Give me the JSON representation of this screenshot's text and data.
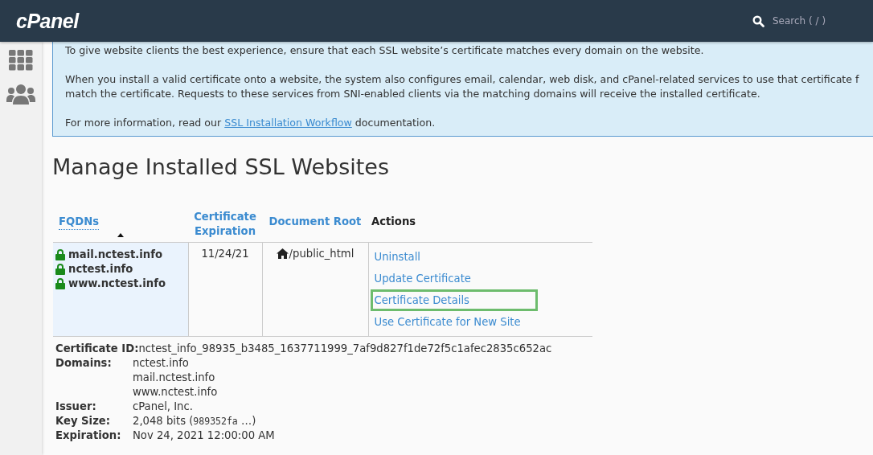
{
  "header": {
    "logo": "cPanel",
    "search": {
      "placeholder": "Search ( / )"
    }
  },
  "sidebar": {
    "items": [
      {
        "kind": "grid"
      },
      {
        "kind": "users"
      }
    ]
  },
  "notice": {
    "paragraphs": [
      {
        "lines": [
          "To give website clients the best experience, ensure that each SSL website’s certificate matches every domain on the website."
        ]
      },
      {
        "lines": [
          "When you install a valid certificate onto a website, the system also configures email, calendar, web disk, and cPanel-related services to use that certificate f",
          "match the certificate. Requests to these services from SNI-enabled clients via the matching domains will receive the installed certificate."
        ]
      },
      {
        "lines": [
          "For more information, read our "
        ],
        "link": "SSL Installation Workflow",
        "after": " documentation."
      }
    ]
  },
  "title": "Manage Installed SSL Websites",
  "table": {
    "columns": [
      {
        "label": "FQDNs",
        "sortable": true,
        "sorted": true
      },
      {
        "label": "Certificate Expiration",
        "sortable": true,
        "sorted": false
      },
      {
        "label": "Document Root",
        "sortable": true,
        "sorted": false
      },
      {
        "label": "Actions",
        "sortable": false,
        "sorted": false
      }
    ],
    "rows": [
      {
        "fqdns": [
          "mail.nctest.info",
          "nctest.info",
          "www.nctest.info"
        ],
        "expiration": "11/24/21",
        "document_root": "/public_html",
        "actions": [
          {
            "label": "Uninstall",
            "highlighted": false
          },
          {
            "label": "Update Certificate",
            "highlighted": false
          },
          {
            "label": "Certificate Details",
            "highlighted": true
          },
          {
            "label": "Use Certificate for New Site",
            "highlighted": false
          }
        ]
      }
    ]
  },
  "details": [
    {
      "label": "Certificate ID:",
      "values": [
        "nctest_info_98935_b3485_1637711999_7af9d827f1de72f5c1afec2835c652ac"
      ]
    },
    {
      "label": "Domains:",
      "values": [
        "nctest.info",
        "mail.nctest.info",
        "www.nctest.info"
      ]
    },
    {
      "label": "Issuer:",
      "values": [
        "cPanel, Inc."
      ]
    },
    {
      "label": "Key Size:",
      "values": [
        "2,048 bits ("
      ],
      "mono": "989352fa",
      "suffix": " …)"
    },
    {
      "label": "Expiration:",
      "values": [
        "Nov 24, 2021 12:00:00 AM"
      ]
    }
  ]
}
